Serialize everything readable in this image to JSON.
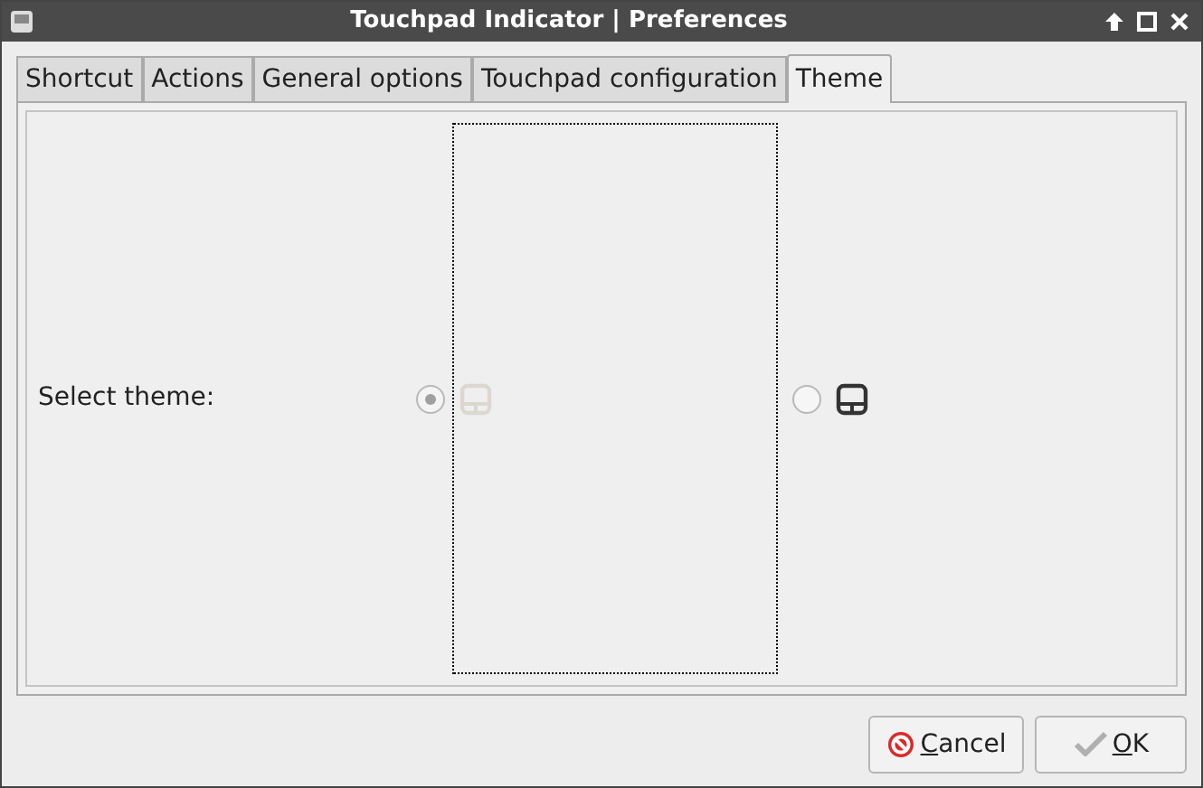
{
  "window": {
    "title": "Touchpad Indicator | Preferences"
  },
  "tabs": [
    {
      "label": "Shortcut",
      "selected": false
    },
    {
      "label": "Actions",
      "selected": false
    },
    {
      "label": "General options",
      "selected": false
    },
    {
      "label": "Touchpad configuration",
      "selected": false
    },
    {
      "label": "Theme",
      "selected": true
    }
  ],
  "theme": {
    "label": "Select theme:",
    "options": [
      {
        "kind": "light",
        "selected": true,
        "focused": true
      },
      {
        "kind": "dark",
        "selected": false,
        "focused": false
      }
    ]
  },
  "buttons": [
    {
      "kind": "cancel",
      "label": "Cancel"
    },
    {
      "kind": "ok",
      "label": "OK"
    }
  ]
}
